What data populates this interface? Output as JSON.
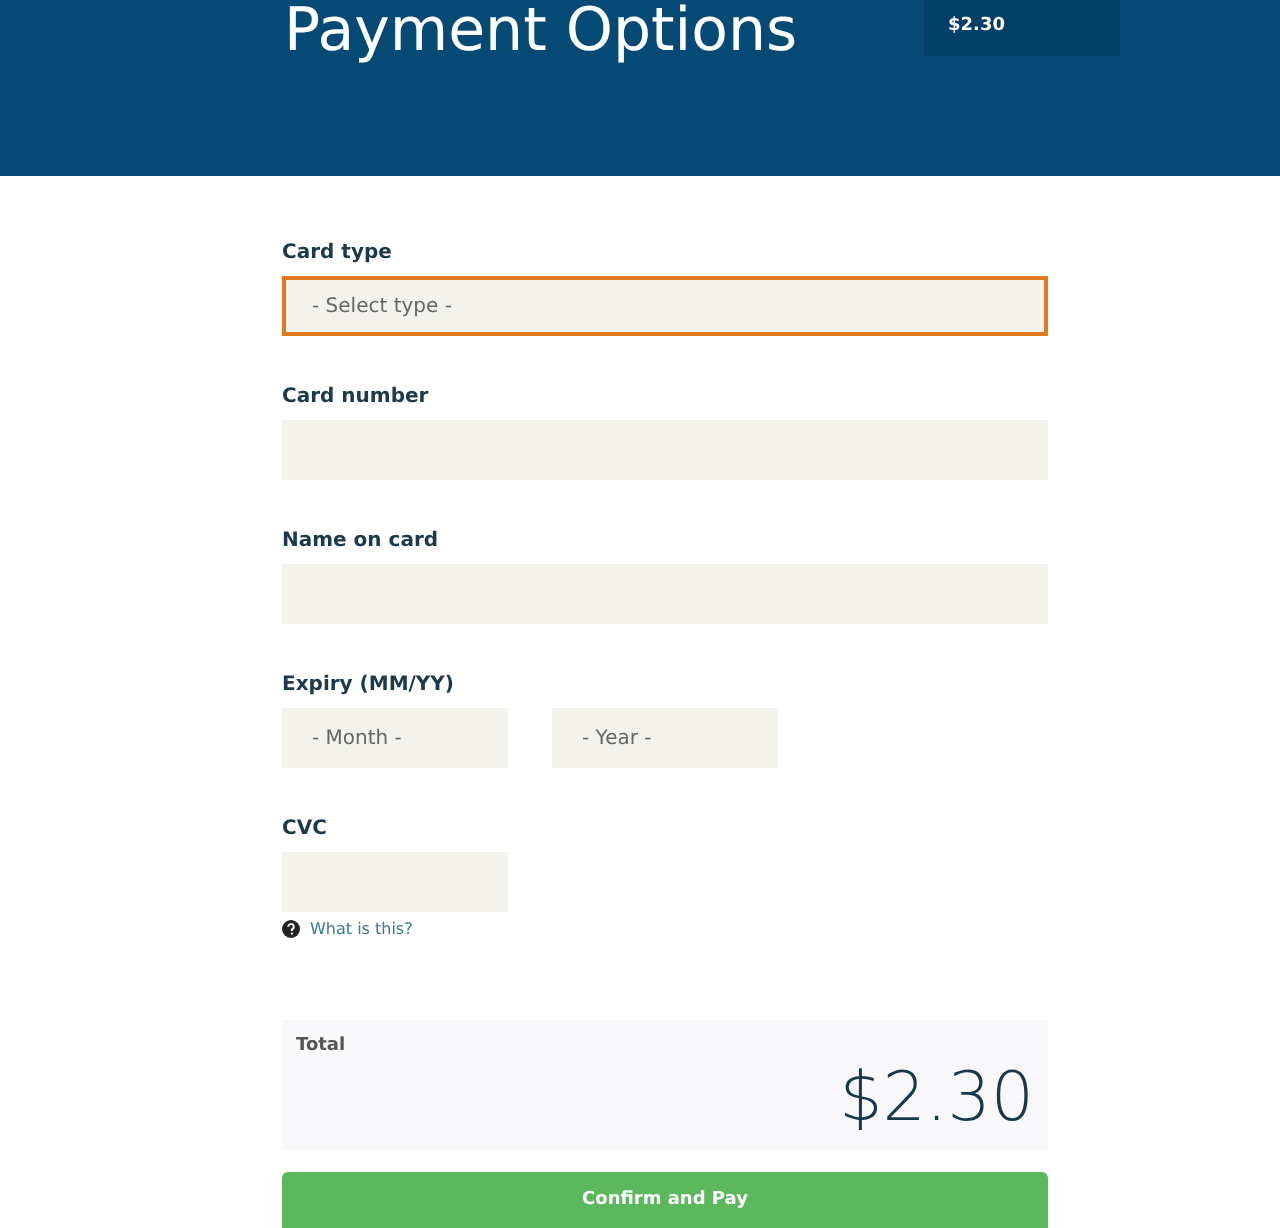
{
  "header": {
    "title": "Payment Options",
    "amount": "$2.30"
  },
  "fields": [
    {
      "label": "Card type",
      "kind": "select",
      "placeholder": "- Select type -",
      "focused": true
    },
    {
      "label": "Card number",
      "kind": "input",
      "focused": false
    },
    {
      "label": "Name on card",
      "kind": "input",
      "focused": false
    },
    {
      "label": "Expiry (MM/YY)",
      "kind": "pair",
      "options": [
        {
          "placeholder": "- Month -"
        },
        {
          "placeholder": "- Year -"
        }
      ]
    },
    {
      "label": "CVC",
      "kind": "short",
      "focused": false,
      "help": "What is this?"
    }
  ],
  "total": {
    "label": "Total",
    "amount": "$2.30"
  },
  "button": "Confirm and Pay"
}
